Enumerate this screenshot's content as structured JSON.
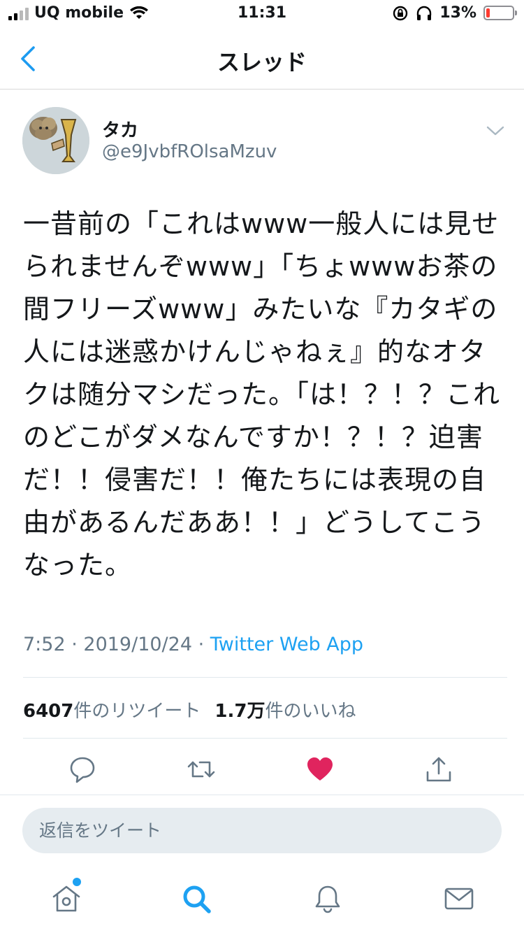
{
  "status_bar": {
    "carrier": "UQ mobile",
    "time": "11:31",
    "battery": "13%",
    "battery_level": 0.13,
    "battery_color": "#ff3b30",
    "signal_bars": 2
  },
  "header": {
    "title": "スレッド",
    "back_icon": "chevron-left-icon"
  },
  "tweet": {
    "display_name": "タカ",
    "handle": "@e9JvbfROlsaMzuv",
    "text": "一昔前の「これはwww一般人には見せられませんぞwww」「ちょwwwお茶の間フリーズwww」みたいな『カタギの人には迷惑かけんじゃねぇ』的なオタクは随分マシだった。「は！？！？これのどこがダメなんですか！？！？迫害だ！！侵害だ！！俺たちには表現の自由があるんだああ！！」どうしてこうなった。",
    "time": "7:52",
    "date": "2019/10/24",
    "separator": " · ",
    "source": "Twitter Web App",
    "retweet_count": "6407",
    "retweet_label": "件のリツイート",
    "like_count": "1.7万",
    "like_label": "件のいいね"
  },
  "actions": [
    "reply-icon",
    "retweet-icon",
    "like-icon",
    "share-icon"
  ],
  "reply": {
    "placeholder": "返信をツイート"
  },
  "tab_bar": [
    "home-icon",
    "search-icon",
    "notifications-icon",
    "messages-icon"
  ],
  "colors": {
    "accent": "#1da1f2",
    "back_arrow": "#1d9bf0",
    "like": "#e0245e",
    "secondary_text": "#657786"
  }
}
